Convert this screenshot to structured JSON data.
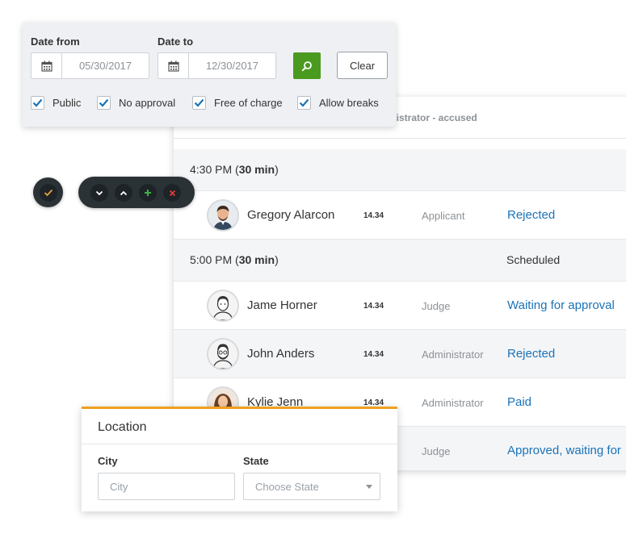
{
  "filter": {
    "date_from_label": "Date from",
    "date_from_value": "05/30/2017",
    "date_to_label": "Date to",
    "date_to_value": "12/30/2017",
    "search_icon": "search-icon",
    "clear_label": "Clear",
    "checkboxes": [
      {
        "label": "Public",
        "checked": true
      },
      {
        "label": "No approval",
        "checked": true
      },
      {
        "label": "Free of charge",
        "checked": true
      },
      {
        "label": "Allow breaks",
        "checked": true
      }
    ]
  },
  "toolbar": {
    "icons": [
      "check-icon",
      "chevron-down-icon",
      "chevron-up-icon",
      "plus-icon",
      "close-icon"
    ]
  },
  "schedule": {
    "header_text": "inistrator - accused",
    "groups": [
      {
        "time": "4:30 PM (",
        "duration": "30 min",
        "close": ")",
        "status": "",
        "rows": [
          {
            "name": "Gregory Alarcon",
            "num": "14.34",
            "role": "Applicant",
            "status": "Rejected"
          }
        ]
      },
      {
        "time": "5:00 PM (",
        "duration": "30 min",
        "close": ")",
        "status": "Scheduled",
        "rows": [
          {
            "name": "Jame Horner",
            "num": "14.34",
            "role": "Judge",
            "status": "Waiting for approval"
          },
          {
            "name": "John Anders",
            "num": "14.34",
            "role": "Administrator",
            "status": "Rejected"
          },
          {
            "name": "Kylie Jenn",
            "num": "14.34",
            "role": "Administrator",
            "status": "Paid"
          },
          {
            "name": "",
            "num": "",
            "role": "Judge",
            "status": "Approved, waiting for"
          }
        ]
      }
    ]
  },
  "location": {
    "title": "Location",
    "city_label": "City",
    "city_placeholder": "City",
    "state_label": "State",
    "state_placeholder": "Choose State"
  },
  "colors": {
    "accent_blue": "#1a73b8",
    "search_green": "#4a9a1f",
    "location_orange": "#f0a020",
    "toolbar_dark": "#2b3236"
  }
}
